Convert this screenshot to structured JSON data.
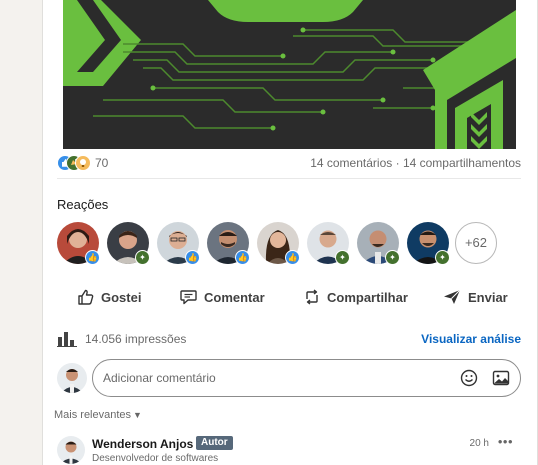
{
  "social": {
    "reaction_count": "70",
    "comments": "14 comentários",
    "separator": "·",
    "shares": "14 compartilhamentos",
    "reaction_icons": [
      "like-icon",
      "celebrate-icon",
      "insightful-icon"
    ]
  },
  "reactions": {
    "title": "Reações",
    "more_label": "+62",
    "avatars": [
      {
        "badge": "like"
      },
      {
        "badge": "celebrate"
      },
      {
        "badge": "like"
      },
      {
        "badge": "like"
      },
      {
        "badge": "like"
      },
      {
        "badge": "celebrate"
      },
      {
        "badge": "celebrate"
      },
      {
        "badge": "celebrate"
      }
    ]
  },
  "actions": {
    "like": "Gostei",
    "comment": "Comentar",
    "share": "Compartilhar",
    "send": "Enviar"
  },
  "impressions": {
    "text": "14.056 impressões",
    "analytics_link": "Visualizar análise"
  },
  "composer": {
    "placeholder": "Adicionar comentário"
  },
  "sort": {
    "label": "Mais relevantes"
  },
  "comment": {
    "author": "Wenderson Anjos",
    "badge": "Autor",
    "headline": "Desenvolvedor de softwares",
    "time": "20 h",
    "menu": "•••"
  },
  "colors": {
    "accent": "#0a66c2",
    "like": "#378fe9",
    "celebrate": "#44712e",
    "image_bg": "#2b2b2b",
    "circuit_green": "#6abf3f"
  }
}
